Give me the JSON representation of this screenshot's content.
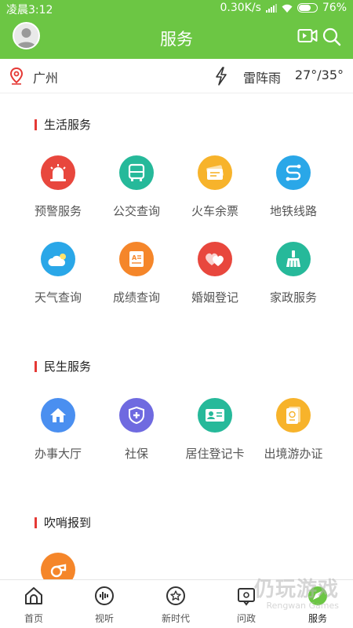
{
  "status_bar": {
    "time": "凌晨3:12",
    "speed": "0.30K/s",
    "battery": "76%",
    "battery_level": 0.76
  },
  "header": {
    "title": "服务"
  },
  "location": {
    "city": "广州",
    "weather": "雷阵雨",
    "temp": "27°/35°"
  },
  "sections": [
    {
      "title": "生活服务",
      "items": [
        {
          "label": "预警服务",
          "icon": "alarm-light-icon",
          "color": "#e8473d"
        },
        {
          "label": "公交查询",
          "icon": "bus-icon",
          "color": "#26b99a"
        },
        {
          "label": "火车余票",
          "icon": "ticket-icon",
          "color": "#f7b32b"
        },
        {
          "label": "地铁线路",
          "icon": "subway-route-icon",
          "color": "#2aa7e8"
        },
        {
          "label": "天气查询",
          "icon": "weather-icon",
          "color": "#2aa7e8"
        },
        {
          "label": "成绩查询",
          "icon": "score-card-icon",
          "color": "#f5862a"
        },
        {
          "label": "婚姻登记",
          "icon": "hearts-icon",
          "color": "#e8473d"
        },
        {
          "label": "家政服务",
          "icon": "broom-icon",
          "color": "#26b99a"
        }
      ]
    },
    {
      "title": "民生服务",
      "items": [
        {
          "label": "办事大厅",
          "icon": "house-icon",
          "color": "#4a8ff0"
        },
        {
          "label": "社保",
          "icon": "shield-plus-icon",
          "color": "#6f6ae0"
        },
        {
          "label": "居住登记卡",
          "icon": "id-card-icon",
          "color": "#26b99a"
        },
        {
          "label": "出境游办证",
          "icon": "passport-icon",
          "color": "#f7b32b"
        }
      ]
    },
    {
      "title": "吹哨报到",
      "items": [
        {
          "label": "",
          "icon": "whistle-icon",
          "color": "#f5862a"
        }
      ]
    }
  ],
  "nav": [
    {
      "label": "首页",
      "icon": "home-icon"
    },
    {
      "label": "视听",
      "icon": "audio-icon"
    },
    {
      "label": "新时代",
      "icon": "star-badge-icon"
    },
    {
      "label": "问政",
      "icon": "message-icon"
    },
    {
      "label": "服务",
      "icon": "compass-icon",
      "active": true
    }
  ],
  "watermark": {
    "text": "仍玩游戏",
    "sub": "Rengwan Games"
  }
}
